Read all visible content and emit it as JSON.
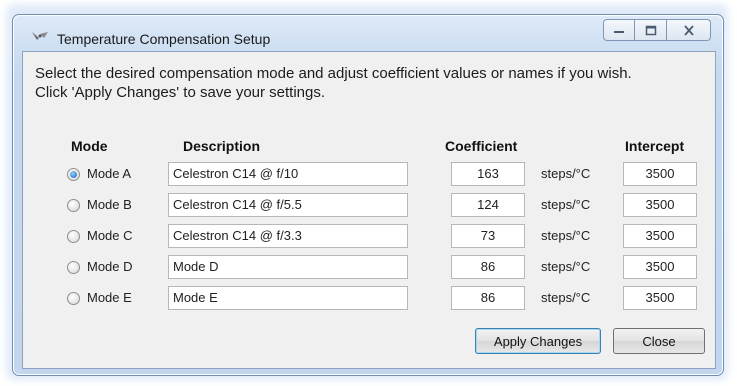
{
  "window": {
    "title": "Temperature Compensation Setup",
    "controls": {
      "minimize_icon": "minimize-icon",
      "maximize_icon": "maximize-icon",
      "close_icon": "close-icon"
    }
  },
  "intro": "Select the desired compensation mode and adjust coefficient values or names if you wish. Click 'Apply Changes' to save your settings.",
  "headers": {
    "mode": "Mode",
    "description": "Description",
    "coefficient": "Coefficient",
    "intercept": "Intercept"
  },
  "modes": [
    {
      "label": "Mode A",
      "description": "Celestron C14 @ f/10",
      "coefficient": "163",
      "unit": "steps/°C",
      "intercept": "3500",
      "selected": true
    },
    {
      "label": "Mode B",
      "description": "Celestron C14 @ f/5.5",
      "coefficient": "124",
      "unit": "steps/°C",
      "intercept": "3500",
      "selected": false
    },
    {
      "label": "Mode C",
      "description": "Celestron C14 @ f/3.3",
      "coefficient": "73",
      "unit": "steps/°C",
      "intercept": "3500",
      "selected": false
    },
    {
      "label": "Mode D",
      "description": "Mode D",
      "coefficient": "86",
      "unit": "steps/°C",
      "intercept": "3500",
      "selected": false
    },
    {
      "label": "Mode E",
      "description": "Mode E",
      "coefficient": "86",
      "unit": "steps/°C",
      "intercept": "3500",
      "selected": false
    }
  ],
  "buttons": {
    "apply": "Apply Changes",
    "close": "Close"
  },
  "colors": {
    "frame": "#c6d9ef",
    "client": "#f0f0f0",
    "radio_selected": "#1a5fae"
  }
}
